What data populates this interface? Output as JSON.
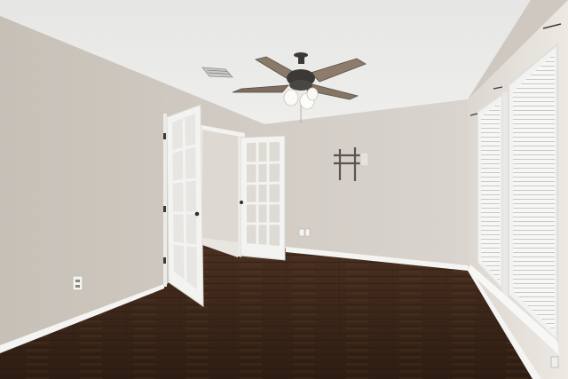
{
  "scene": {
    "colors": {
      "ceiling": "#e9e9e7",
      "wall_left": "#cbc4bb",
      "wall_back": "#d6d0c9",
      "wall_right": "#e2ddd7",
      "floor": "#3a2519",
      "floor_light": "#5a3a28",
      "trim": "#f6f6f4",
      "fan_blade": "#8a7a6a",
      "fan_body": "#3b3835"
    },
    "icons": [
      "ceiling-fan-icon",
      "door-icon",
      "window-blinds-icon",
      "tv-mount-icon",
      "outlet-icon",
      "air-vent-icon"
    ]
  }
}
